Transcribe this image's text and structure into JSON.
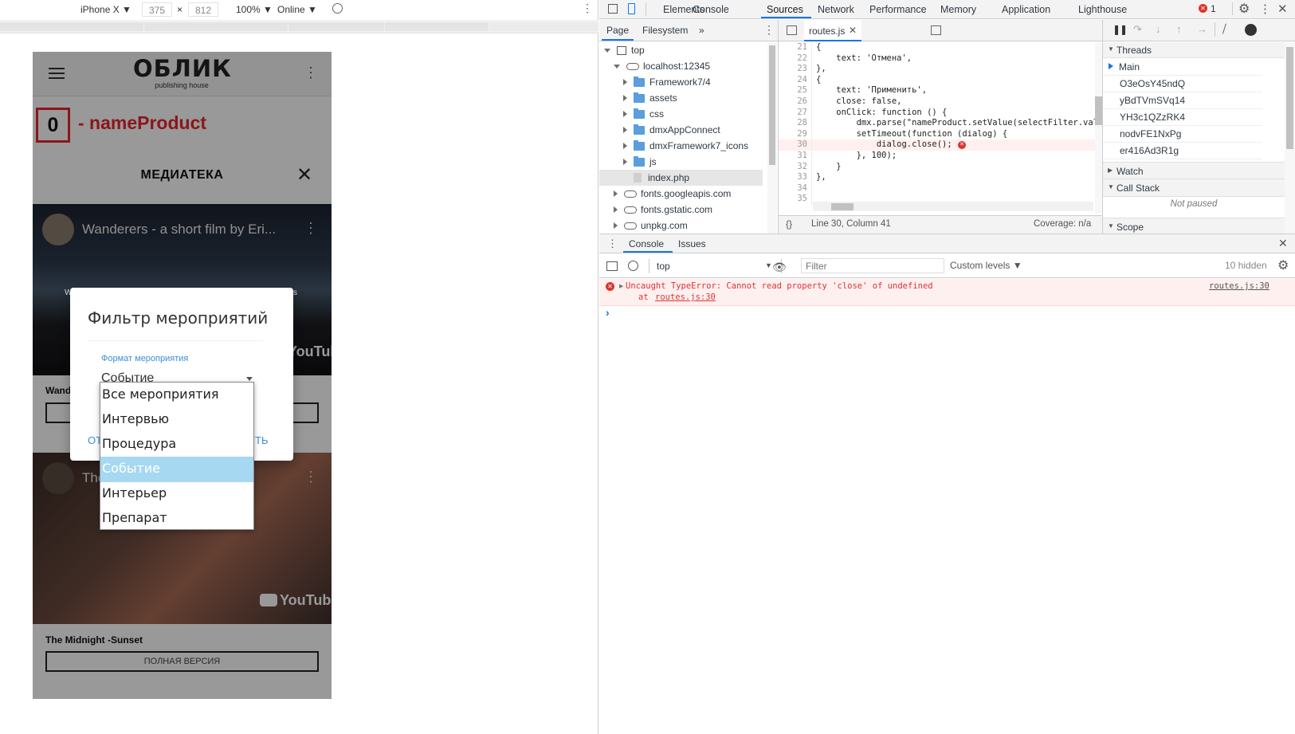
{
  "devtools_toolbar": {
    "device": "iPhone X ▼",
    "width": "375",
    "x": "×",
    "height": "812",
    "zoom": "100% ▼",
    "network": "Online ▼"
  },
  "phone": {
    "brand": "ОБЛИК",
    "brand_sub": "publishing house",
    "counter": "0",
    "annotation": "- nameProduct",
    "section_title": "МЕДИАТЕКА",
    "video1_title": "Wanderers - a short film by Eri...",
    "video1_caption": "Wand",
    "youtube": "YouTube",
    "video2_title": "The",
    "video2_caption": "The Midnight -Sunset",
    "full_version": "ПОЛНАЯ ВЕРСИЯ",
    "dialog": {
      "title": "Фильтр мероприятий",
      "field_label": "Формат мероприятия",
      "field_value": "Событие",
      "cancel_fragment": "ОТ",
      "apply_fragment": "ТЬ",
      "bg_fragment_left": "W",
      "bg_fragment_right": "s"
    },
    "dropdown": [
      "Все мероприятия",
      "Интервью",
      "Процедура",
      "Событие",
      "Интерьер",
      "Препарат"
    ],
    "dropdown_selected_index": 3
  },
  "devtools": {
    "main_tabs": [
      "Elements",
      "Console",
      "Sources",
      "Network",
      "Performance",
      "Memory",
      "Application",
      "Lighthouse"
    ],
    "active_tab": "Sources",
    "error_count": "1",
    "nav_tabs": [
      "Page",
      "Filesystem",
      "»"
    ],
    "tree": [
      {
        "label": "top",
        "level": 0,
        "kind": "frame"
      },
      {
        "label": "localhost:12345",
        "level": 1,
        "kind": "cloud"
      },
      {
        "label": "Framework7/4",
        "level": 2,
        "kind": "folder"
      },
      {
        "label": "assets",
        "level": 2,
        "kind": "folder"
      },
      {
        "label": "css",
        "level": 2,
        "kind": "folder"
      },
      {
        "label": "dmxAppConnect",
        "level": 2,
        "kind": "folder"
      },
      {
        "label": "dmxFramework7_icons",
        "level": 2,
        "kind": "folder"
      },
      {
        "label": "js",
        "level": 2,
        "kind": "folder"
      },
      {
        "label": "index.php",
        "level": 2,
        "kind": "file"
      },
      {
        "label": "fonts.googleapis.com",
        "level": 1,
        "kind": "cloud"
      },
      {
        "label": "fonts.gstatic.com",
        "level": 1,
        "kind": "cloud"
      },
      {
        "label": "unpkg.com",
        "level": 1,
        "kind": "cloud"
      }
    ],
    "editor_tab": "routes.js",
    "code_lines": [
      {
        "n": "21",
        "t": "{"
      },
      {
        "n": "22",
        "t": "    text: 'Отмена',"
      },
      {
        "n": "23",
        "t": "},"
      },
      {
        "n": "24",
        "t": "{"
      },
      {
        "n": "25",
        "t": "    text: 'Применить',"
      },
      {
        "n": "26",
        "t": "    close: false,"
      },
      {
        "n": "27",
        "t": "    onClick: function () {"
      },
      {
        "n": "28",
        "t": "        dmx.parse(\"nameProduct.setValue(selectFilter.val"
      },
      {
        "n": "29",
        "t": "        setTimeout(function (dialog) {"
      },
      {
        "n": "30",
        "t": "            dialog.close();"
      },
      {
        "n": "31",
        "t": "        }, 100);"
      },
      {
        "n": "32",
        "t": "    }"
      },
      {
        "n": "33",
        "t": "},"
      },
      {
        "n": "34",
        "t": ""
      },
      {
        "n": "35",
        "t": ""
      }
    ],
    "status_position": "Line 30, Column 41",
    "status_coverage": "Coverage: n/a",
    "threads_header": "Threads",
    "threads": [
      "Main",
      "O3eOsY45ndQ",
      "yBdTVmSVq14",
      "YH3c1QZzRK4",
      "nodvFE1NxPg",
      "er416Ad3R1g"
    ],
    "watch": "Watch",
    "call_stack": "Call Stack",
    "not_paused": "Not paused",
    "scope": "Scope",
    "drawer_tabs": [
      "Console",
      "Issues"
    ],
    "context": "top",
    "filter_placeholder": "Filter",
    "levels": "Custom levels ▼",
    "hidden": "10 hidden",
    "error_message": "Uncaught TypeError: Cannot read property 'close' of undefined",
    "error_at": "at ",
    "error_link": "routes.js:30",
    "error_source": "routes.js:30",
    "prompt": "›"
  }
}
